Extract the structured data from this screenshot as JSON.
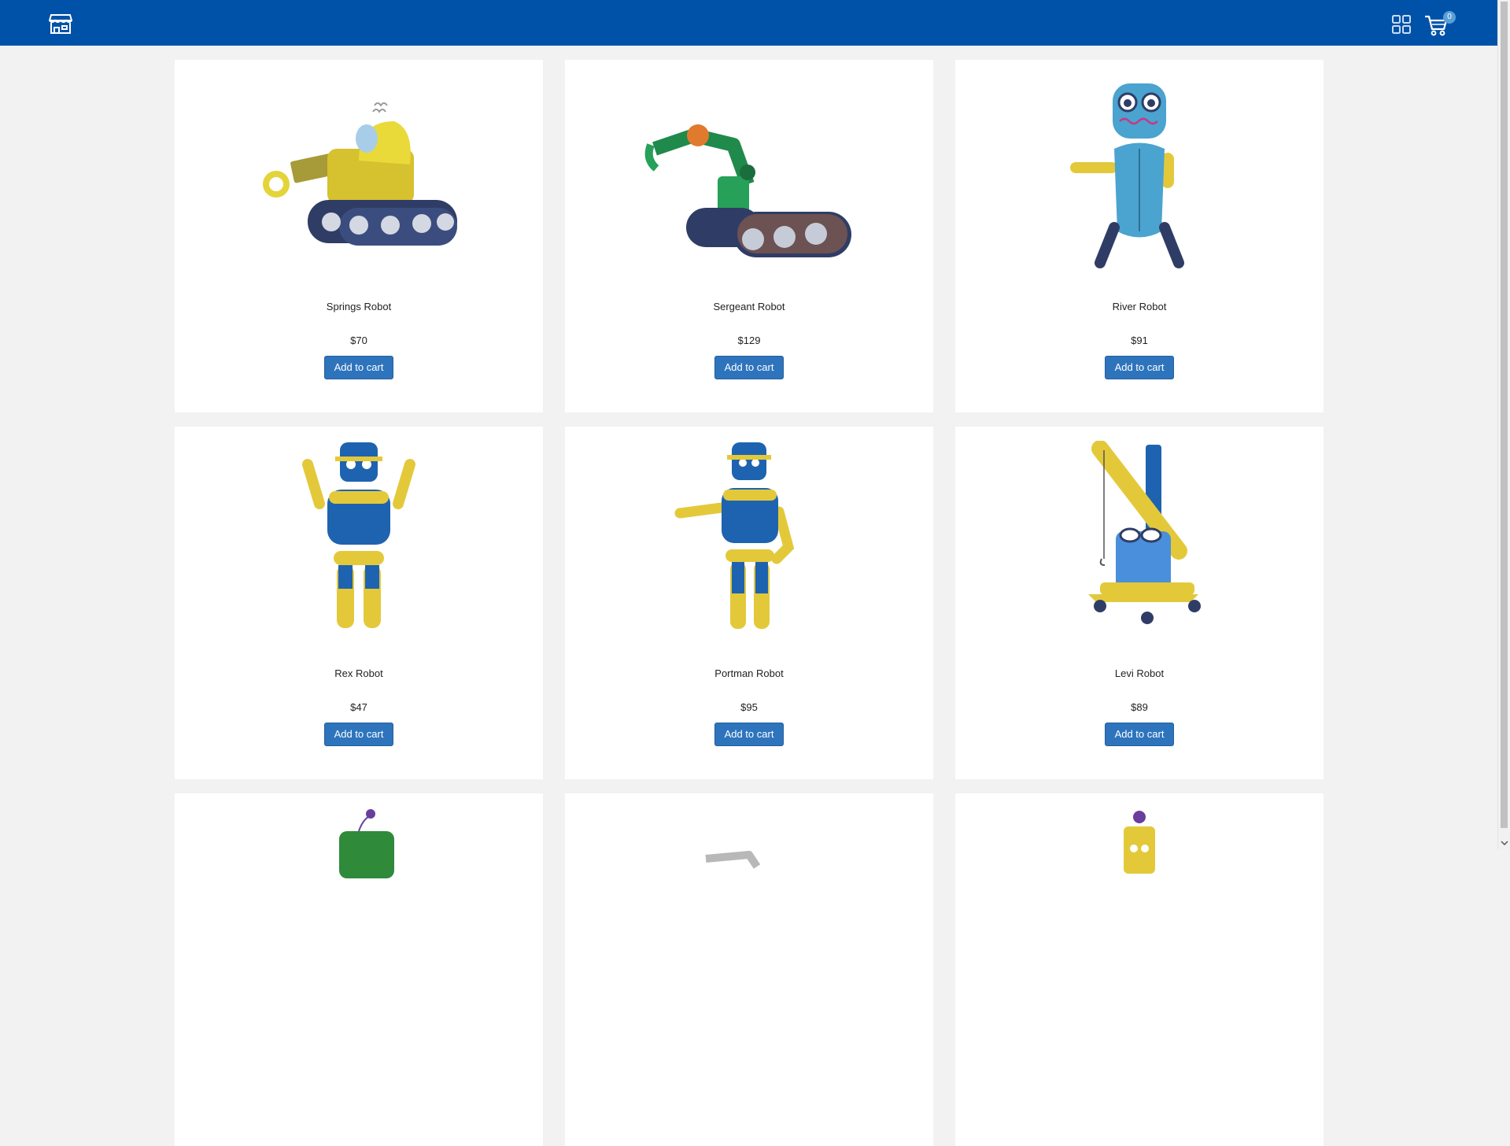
{
  "header": {
    "store_icon": "storefront-icon",
    "grid_icon": "grid-view-icon",
    "cart_icon": "shopping-cart-icon",
    "cart_count": "0",
    "colors": {
      "bar": "#0052a8",
      "button": "#2e74bd"
    }
  },
  "products": [
    {
      "name": "Springs Robot",
      "price": "$70",
      "button": "Add to cart"
    },
    {
      "name": "Sergeant Robot",
      "price": "$129",
      "button": "Add to cart"
    },
    {
      "name": "River Robot",
      "price": "$91",
      "button": "Add to cart"
    },
    {
      "name": "Rex Robot",
      "price": "$47",
      "button": "Add to cart"
    },
    {
      "name": "Portman Robot",
      "price": "$95",
      "button": "Add to cart"
    },
    {
      "name": "Levi Robot",
      "price": "$89",
      "button": "Add to cart"
    }
  ]
}
